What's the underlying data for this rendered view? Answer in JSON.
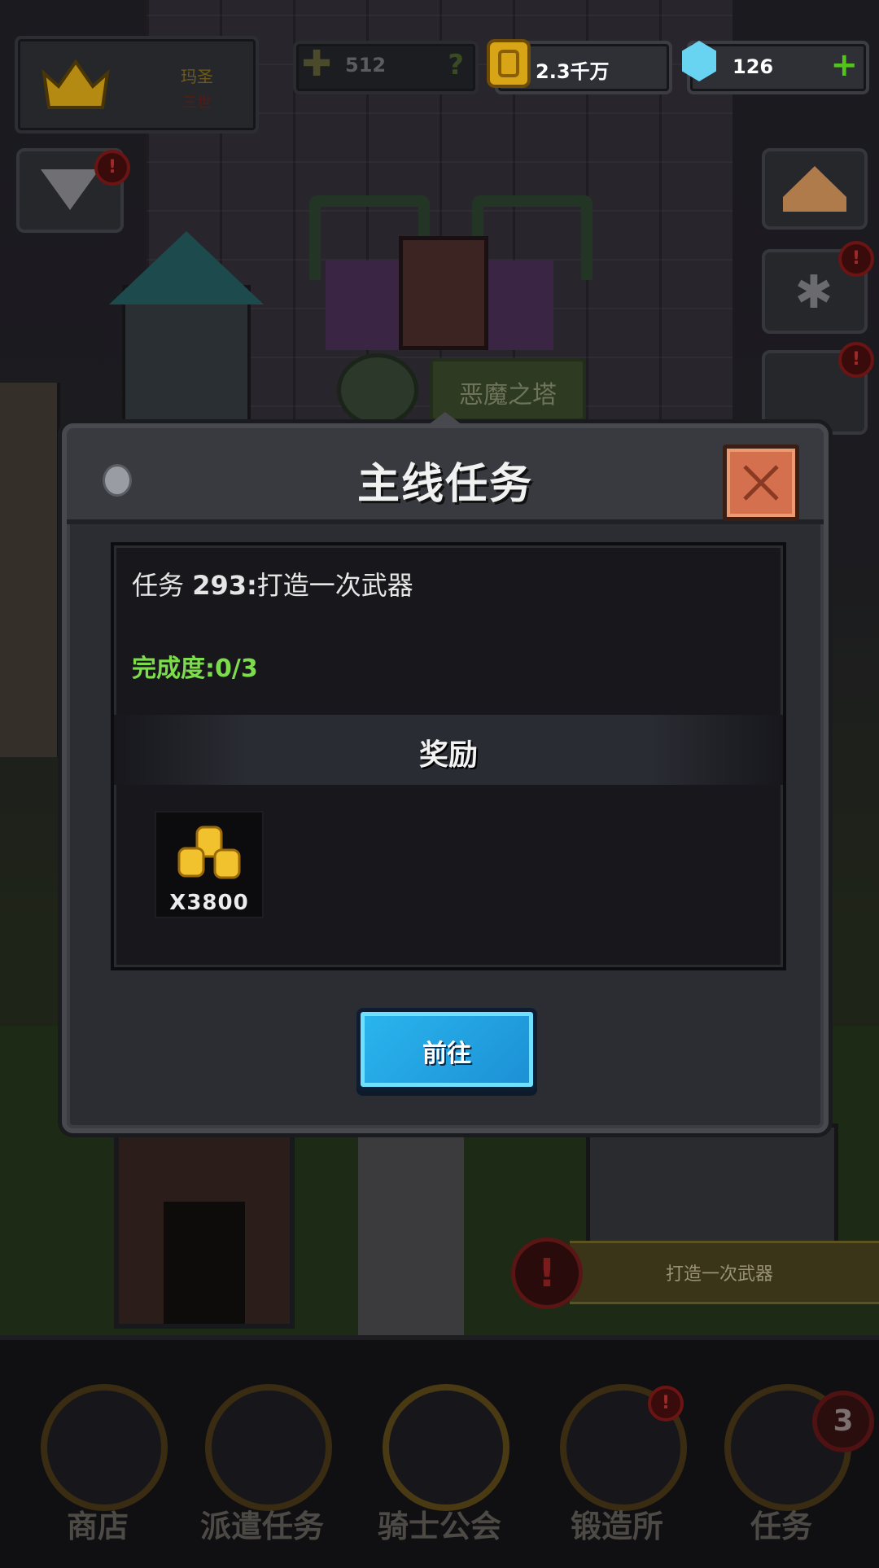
{
  "hud": {
    "profile_name": "玛圣",
    "profile_rank": "三世",
    "power": "512",
    "power_help": "?",
    "coins": "2.3千万",
    "gems": "126",
    "gems_add": "+"
  },
  "world": {
    "tower_sign": "恶魔之塔",
    "notice_text": "打造一次武器",
    "notice_icon": "!"
  },
  "dialog": {
    "title": "主线任务",
    "task_prefix": "任务",
    "task_number": "293:",
    "task_desc": "打造一次武器",
    "progress_label": "完成度:",
    "progress_value": "0/3",
    "reward_label": "奖励",
    "reward_item": {
      "icon": "gold-coin-pile-icon",
      "quantity": "X3800"
    },
    "go_button": "前往"
  },
  "side_buttons": [
    {
      "name": "mail",
      "badge": "!"
    },
    {
      "name": "home",
      "badge": ""
    },
    {
      "name": "settings",
      "badge": "!"
    },
    {
      "name": "event",
      "badge": "!"
    }
  ],
  "bottom_nav": [
    {
      "label": "商店",
      "badge": ""
    },
    {
      "label": "派遣任务",
      "badge": ""
    },
    {
      "label": "骑士公会",
      "badge": ""
    },
    {
      "label": "锻造所",
      "badge": "!"
    },
    {
      "label": "任务",
      "badge": "3"
    }
  ],
  "colors": {
    "progress_green": "#7ddc4c",
    "go_button_blue": "#2ab6ee",
    "close_button": "#d5704e",
    "gem_plus": "#53c41b"
  }
}
